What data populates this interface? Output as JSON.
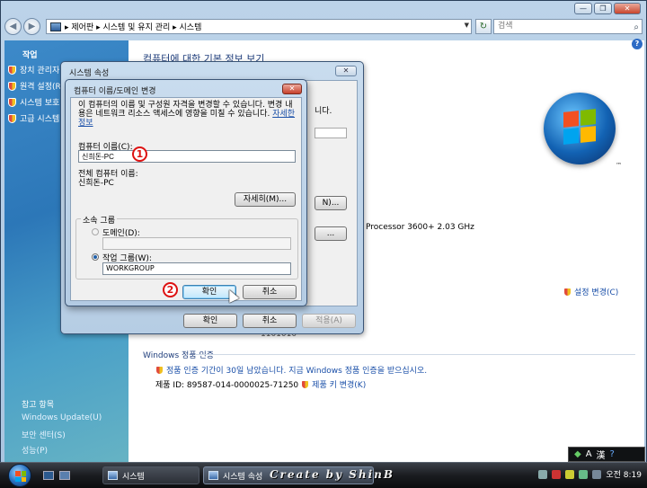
{
  "window": {
    "controls": {
      "minimize": "—",
      "maximize": "❐",
      "close": "✕"
    }
  },
  "address_bar": {
    "path": "▸ 제어판 ▸ 시스템 및 유지 관리 ▸ 시스템",
    "search_placeholder": "검색"
  },
  "task_pane": {
    "title": "작업",
    "items": [
      {
        "label": "장치 관리자",
        "icon": "shield-icon"
      },
      {
        "label": "원격 설정(R)",
        "icon": "shield-icon"
      },
      {
        "label": "시스템 보호",
        "icon": "shield-icon"
      },
      {
        "label": "고급 시스템",
        "icon": "shield-icon"
      }
    ],
    "see_also_title": "참고 항목",
    "see_also": [
      "Windows Update(U)",
      "보안 센터(S)",
      "성능(P)"
    ]
  },
  "main": {
    "title": "컴퓨터에 대한 기본 정보 보기",
    "processor": "Processor 3600+   2.03 GHz",
    "settings_change": "설정 변경(C)",
    "activation_title": "Windows 정품 인증",
    "activation_notice": "정품 인증 기간이 30일 남았습니다. 지금 Windows 정품 인증을 받으십시오.",
    "product_id": "제품 ID: 89587-014-0000025-71250",
    "change_key": "제품 키 변경(K)",
    "frag_text": "1101010",
    "trademark": "™"
  },
  "system_properties": {
    "title": "시스템 속성",
    "close": "✕",
    "ghost_text": "니다.",
    "ghost_btn1": "N)...",
    "ghost_btn2": "...",
    "ok": "확인",
    "cancel": "취소",
    "apply": "적용(A)"
  },
  "name_change": {
    "title": "컴퓨터 이름/도메인 변경",
    "close": "✕",
    "description": "이 컴퓨터의 이름 및 구성원 자격을 변경할 수 있습니다. 변경 내용은 네트워크 리소스 액세스에 영향을 미칠 수 있습니다.",
    "details_link": "자세한 정보",
    "computer_name_label": "컴퓨터 이름(C):",
    "computer_name_value": "신희돈-PC",
    "full_name_label": "전체 컴퓨터 이름:",
    "full_name_value": "신희돈-PC",
    "more_button": "자세히(M)...",
    "member_of": "소속 그룹",
    "domain_label": "도메인(D):",
    "workgroup_label": "작업 그룹(W):",
    "workgroup_value": "WORKGROUP",
    "ok": "확인",
    "cancel": "취소"
  },
  "callouts": {
    "one": "1",
    "two": "2"
  },
  "taskbar": {
    "tasks": [
      "시스템",
      "시스템 속성"
    ],
    "watermark": "Create by ShinB",
    "clock": "오전 8:19"
  },
  "langbar": {
    "lang": "A",
    "hanja": "漢",
    "help": "?"
  },
  "colors": {
    "accent": "#1a4fa8",
    "callout": "#dd1111"
  }
}
